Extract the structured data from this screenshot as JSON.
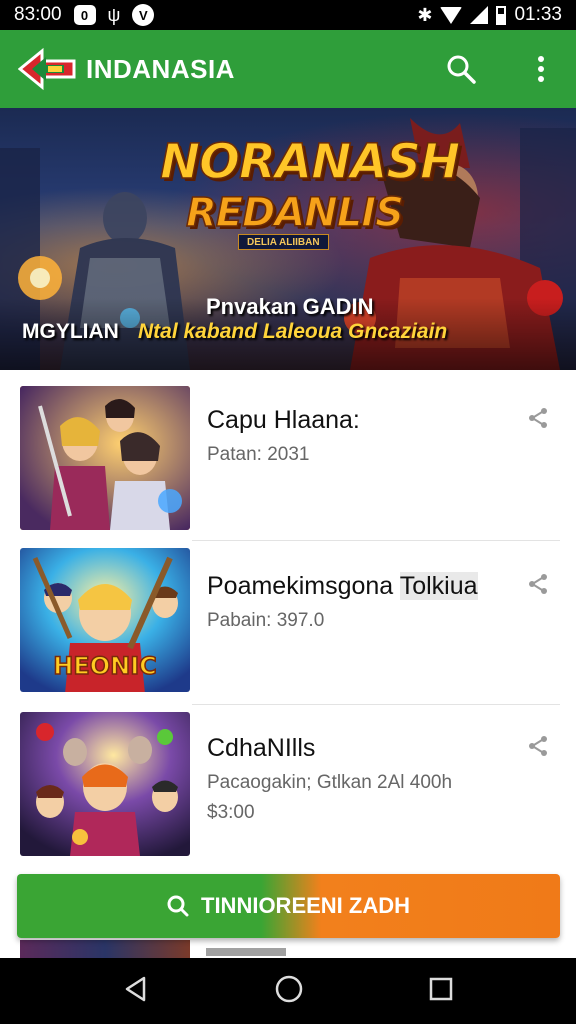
{
  "status": {
    "time_left": "83:00",
    "notif_badge": "0",
    "notif_circle": "V",
    "time_right": "01:33"
  },
  "app_bar": {
    "title": "INDANASIA",
    "brand_color": "#2f9e3a"
  },
  "hero": {
    "title_line1": "NORANASH",
    "title_line2": "REDANLIS",
    "badge": "DELIA ALIIBAN",
    "subtitle": "Pnvakan GADIN",
    "left_label": "MGYLIAN",
    "tagline": "Ntal kaband Laleoua Gncaziain"
  },
  "items": [
    {
      "title": "Capu Hlaana:",
      "meta": "Patan: 2031",
      "price": ""
    },
    {
      "title": "Poamekimsgona",
      "title_highlight": "Tolkiua",
      "meta": "Pabain: 397.0",
      "price": ""
    },
    {
      "title": "CdhaNIlls",
      "meta": "Pacaogakin; Gtlkan 2Al 400h",
      "price": "$3:00"
    }
  ],
  "thumb2_caption": "HEONIC",
  "cta": {
    "label": "TINNIOREENI ZADH",
    "color_left": "#3aa534",
    "color_right": "#f2801c"
  },
  "icons": {
    "back": "back-triangle-icon",
    "home": "home-circle-icon",
    "recents": "recents-square-icon",
    "search": "search-icon",
    "menu": "more-vertical-icon",
    "share": "share-icon"
  }
}
